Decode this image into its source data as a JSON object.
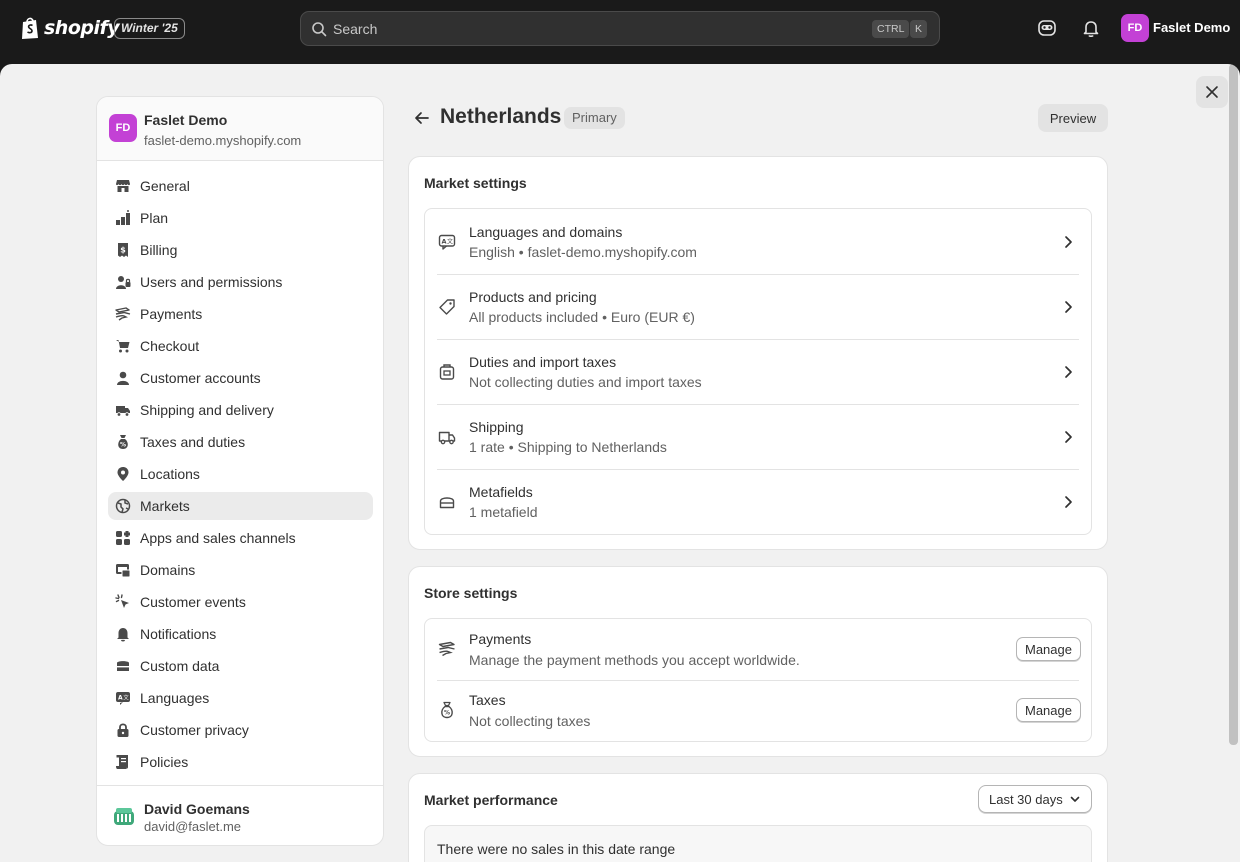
{
  "topbar": {
    "logo_text": "shopify",
    "edition_badge": "Winter '25",
    "search_placeholder": "Search",
    "shortcut_key1": "CTRL",
    "shortcut_key2": "K",
    "user_initials": "FD",
    "user_name": "Faslet Demo"
  },
  "sidebar": {
    "store_initials": "FD",
    "store_name": "Faslet Demo",
    "store_url": "faslet-demo.myshopify.com",
    "items": [
      {
        "label": "General",
        "icon": "store-icon"
      },
      {
        "label": "Plan",
        "icon": "plan-icon"
      },
      {
        "label": "Billing",
        "icon": "billing-icon"
      },
      {
        "label": "Users and permissions",
        "icon": "users-icon"
      },
      {
        "label": "Payments",
        "icon": "payments-icon"
      },
      {
        "label": "Checkout",
        "icon": "cart-icon"
      },
      {
        "label": "Customer accounts",
        "icon": "person-icon"
      },
      {
        "label": "Shipping and delivery",
        "icon": "truck-icon"
      },
      {
        "label": "Taxes and duties",
        "icon": "tax-bag-icon"
      },
      {
        "label": "Locations",
        "icon": "location-pin-icon"
      },
      {
        "label": "Markets",
        "icon": "globe-icon",
        "active": true
      },
      {
        "label": "Apps and sales channels",
        "icon": "apps-icon"
      },
      {
        "label": "Domains",
        "icon": "domains-icon"
      },
      {
        "label": "Customer events",
        "icon": "cursor-click-icon"
      },
      {
        "label": "Notifications",
        "icon": "bell-icon"
      },
      {
        "label": "Custom data",
        "icon": "database-icon"
      },
      {
        "label": "Languages",
        "icon": "language-icon"
      },
      {
        "label": "Customer privacy",
        "icon": "lock-icon"
      },
      {
        "label": "Policies",
        "icon": "policy-icon"
      }
    ],
    "footer": {
      "name": "David Goemans",
      "email": "david@faslet.me"
    }
  },
  "header": {
    "title": "Netherlands",
    "badge": "Primary",
    "preview_label": "Preview"
  },
  "market_settings": {
    "title": "Market settings",
    "rows": [
      {
        "title": "Languages and domains",
        "subtitle": "English • faslet-demo.myshopify.com",
        "icon": "language-icon"
      },
      {
        "title": "Products and pricing",
        "subtitle": "All products included • Euro (EUR €)",
        "icon": "price-tag-icon"
      },
      {
        "title": "Duties and import taxes",
        "subtitle": "Not collecting duties and import taxes",
        "icon": "duties-icon"
      },
      {
        "title": "Shipping",
        "subtitle": "1 rate • Shipping to Netherlands",
        "icon": "truck-icon"
      },
      {
        "title": "Metafields",
        "subtitle": "1 metafield",
        "icon": "metafields-icon"
      }
    ]
  },
  "store_settings": {
    "title": "Store settings",
    "rows": [
      {
        "title": "Payments",
        "subtitle": "Manage the payment methods you accept worldwide.",
        "button": "Manage",
        "icon": "payments-icon"
      },
      {
        "title": "Taxes",
        "subtitle": "Not collecting taxes",
        "button": "Manage",
        "icon": "tax-bag-icon"
      }
    ]
  },
  "market_performance": {
    "title": "Market performance",
    "date_range": "Last 30 days",
    "empty_message": "There were no sales in this date range"
  },
  "colors": {
    "topbar_bg": "#1a1a1a",
    "avatar": "#c341d5",
    "page_bg": "#f1f1f1"
  }
}
